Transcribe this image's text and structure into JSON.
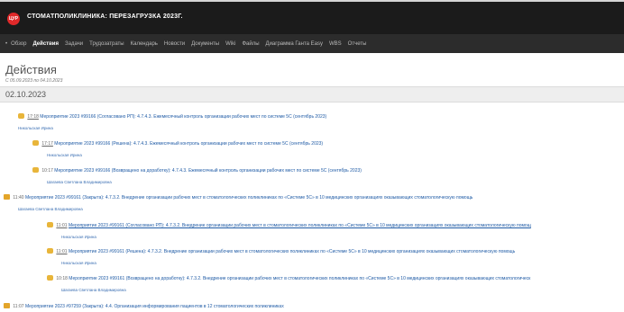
{
  "header": {
    "logo_text": "ЦУР",
    "title": "СТОМАТПОЛИКЛИНИКА: ПЕРЕЗАГРУЗКА 2023Г."
  },
  "nav": {
    "items": [
      "Обзор",
      "Действия",
      "Задачи",
      "Трудозатраты",
      "Календарь",
      "Новости",
      "Документы",
      "Wiki",
      "Файлы",
      "Диаграмма Ганта Easy",
      "WBS",
      "Отчеты"
    ],
    "active": "Действия"
  },
  "page": {
    "title": "Действия",
    "date_range": "С 05.09.2023 по 04.10.2023",
    "date_group": "02.10.2023"
  },
  "entries": [
    {
      "time": "17:18",
      "title": "Мероприятие 2023 #99166 (Согласовано РП): 4.7.4.3. Ежемесячный контроль организации рабочих мест по системе 5С (сентябрь 2023)",
      "author": "Никольская Ирина"
    },
    {
      "time": "17:17",
      "title": "Мероприятие 2023 #99166 (Решена): 4.7.4.3. Ежемесячный контроль организации рабочих мест по системе 5С (сентябрь 2023)",
      "author": "Никольская Ирина"
    },
    {
      "time": "10:17",
      "title": "Мероприятие 2023 #99166 (Возвращено на доработку): 4.7.4.3. Ежемесячный контроль организации рабочих мест по системе 5С (сентябрь 2023)",
      "author": "Шагаева Светлана Владимировна"
    },
    {
      "time": "11:40",
      "title": "Мероприятие 2023 #99161 (Закрыта): 4.7.3.2. Внедрение организации рабочих мест в стоматологических поликлиниках по «Системе 5С» в 10 медицинских организациях оказывающих стоматологическую помощь",
      "author": "Шагаева Светлана Владимировна"
    },
    {
      "time": "11:01",
      "title": "Мероприятие 2023 #99161 (Согласовано РП): 4.7.3.2. Внедрение организации рабочих мест в стоматологических поликлиниках по «Системе 5С» в 10 медицинских организациях оказывающих стоматологическую помощ",
      "author": "Никольская Ирина"
    },
    {
      "time": "11:01",
      "title": "Мероприятие 2023 #99161 (Решена): 4.7.3.2. Внедрение организации рабочих мест в стоматологических поликлиниках по «Системе 5С» в 10 медицинских организациях оказывающих стоматологическую помощь",
      "author": "Никольская Ирина"
    },
    {
      "time": "10:18",
      "title": "Мероприятие 2023 #99161 (Возвращено на доработку): 4.7.3.2. Внедрение организации рабочих мест в стоматологических поликлиниках по «Системе 5С» в 10 медицинских организациях оказывающих стоматологическ",
      "author": "Шагаева Светлана Владимировна"
    },
    {
      "time": "11:07",
      "title": "Мероприятие 2023 #97259 (Закрыта): 4.4. Организация информирования пациентов в 12 стоматологических поликлиниках",
      "author": ""
    }
  ]
}
